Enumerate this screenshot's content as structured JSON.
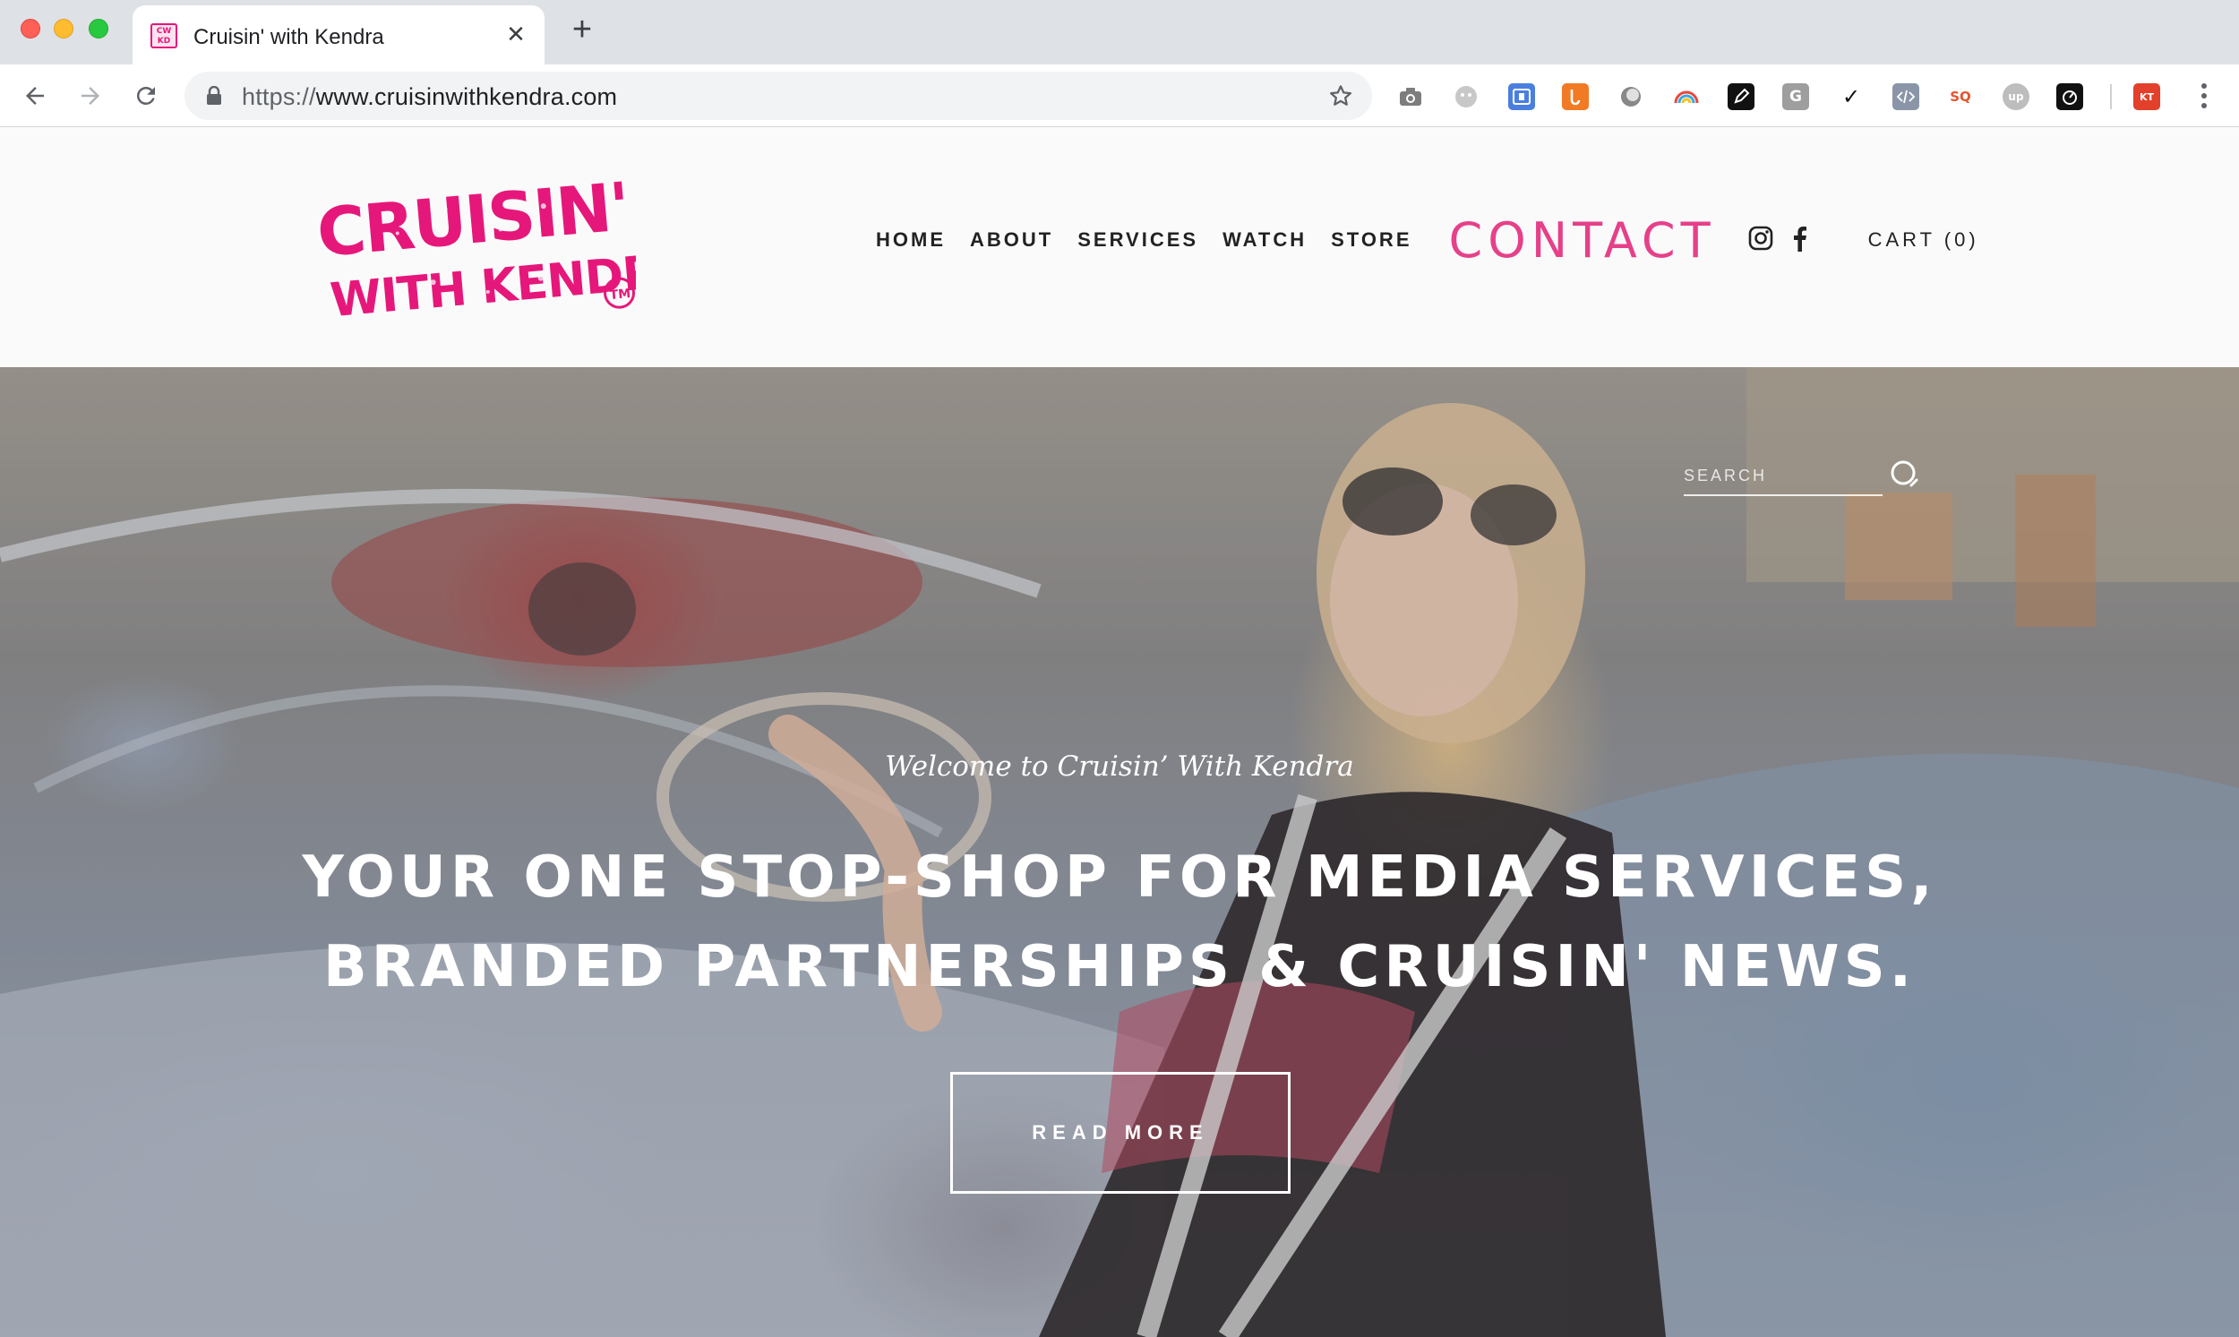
{
  "browser": {
    "tab_title": "Cruisin' with Kendra",
    "tab_favicon_text": "CRUISIN WITH KENDRA",
    "url_scheme": "https://",
    "url_host": "www.cruisinwithkendra.com",
    "extensions": [
      "camera-icon",
      "face-icon",
      "translate-icon",
      "hubspot-icon",
      "circle-icon",
      "rainbow-icon",
      "pen-icon",
      "grammarly-icon",
      "check-icon",
      "code-icon",
      "seo-icon",
      "upwork-icon",
      "timer-icon",
      "fox-icon"
    ],
    "extension_labels": {
      "grammarly": "G",
      "seo": "SQ",
      "upwork": "up",
      "fox": "KT"
    }
  },
  "site": {
    "logo_line1": "CRUISIN'",
    "logo_line2": "WITH KENDRA",
    "logo_tm": "TM",
    "brand_color": "#e6408a",
    "nav": {
      "home": "HOME",
      "about": "ABOUT",
      "services": "SERVICES",
      "watch": "WATCH",
      "store": "STORE",
      "contact": "CONTACT",
      "cart": "CART (0)"
    },
    "social": [
      "instagram-icon",
      "facebook-icon"
    ]
  },
  "hero": {
    "search_placeholder": "SEARCH",
    "kicker": "Welcome to Cruisin’ With Kendra",
    "headline_line1": "YOUR ONE STOP-SHOP FOR MEDIA SERVICES,",
    "headline_line2": "BRANDED PARTNERSHIPS & CRUISIN' NEWS.",
    "cta": "READ MORE"
  }
}
